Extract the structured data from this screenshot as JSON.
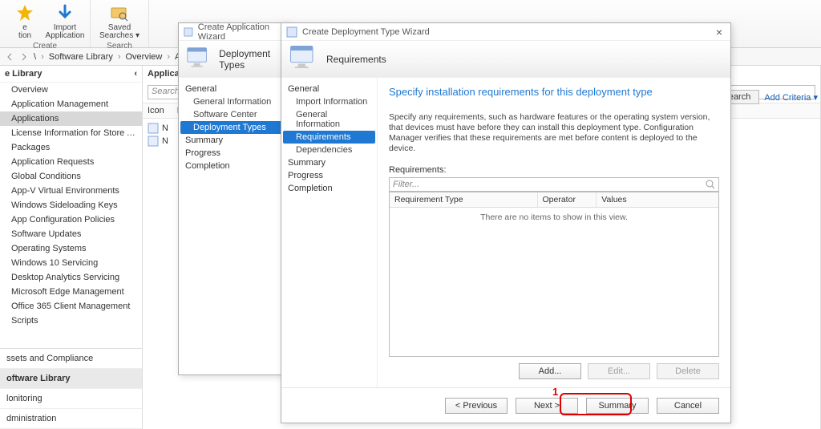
{
  "ribbon": {
    "group1": {
      "btn1a": "e",
      "btn1b": "tion",
      "btn2a": "Import",
      "btn2b": "Application",
      "label": "Create"
    },
    "group2": {
      "btn1a": "Saved",
      "btn1b": "Searches ▾",
      "label": "Search"
    }
  },
  "breadcrumb": {
    "items": [
      "\\",
      "›",
      "Software Library",
      "›",
      "Overview",
      "›",
      "Ap"
    ]
  },
  "navtree": {
    "title": "e Library",
    "nodes": [
      "Overview",
      "Application Management",
      "Applications",
      "License Information for Store Apps",
      "Packages",
      "Application Requests",
      "Global Conditions",
      "App-V Virtual Environments",
      "Windows Sideloading Keys",
      "App Configuration Policies",
      "Software Updates",
      "Operating Systems",
      "Windows 10 Servicing",
      "Desktop Analytics Servicing",
      "Microsoft Edge Management",
      "Office 365 Client Management",
      "Scripts"
    ],
    "sections": [
      "ssets and Compliance",
      "oftware Library",
      "lonitoring",
      "dministration"
    ]
  },
  "listpane": {
    "title": "Application",
    "search_placeholder": "Search",
    "columns": [
      "Icon",
      "N"
    ],
    "row_text": "N"
  },
  "right": {
    "search": "Search",
    "criteria": "Add Criteria ▾"
  },
  "wizard_back": {
    "title": "Create Application Wizard",
    "header": "Deployment Types",
    "nav_groups": [
      "General"
    ],
    "nav_items": [
      "General Information",
      "Software Center",
      "Deployment Types"
    ],
    "after_items": [
      "Summary",
      "Progress",
      "Completion"
    ]
  },
  "wizard_front": {
    "title": "Create Deployment Type Wizard",
    "header": "Requirements",
    "nav": {
      "group": "General",
      "items": [
        "Import Information",
        "General Information",
        "Requirements",
        "Dependencies"
      ],
      "tail": [
        "Summary",
        "Progress",
        "Completion"
      ]
    },
    "heading": "Specify installation requirements for this deployment type",
    "desc": "Specify any requirements, such as hardware features or the operating system version, that devices must have before they can install this deployment type. Configuration Manager verifies that these requirements are met before content is deployed to the device.",
    "requirements_label": "Requirements:",
    "filter_placeholder": "Filter...",
    "grid_cols": [
      "Requirement Type",
      "Operator",
      "Values"
    ],
    "grid_empty": "There are no items to show in this view.",
    "btn_add": "Add...",
    "btn_edit": "Edit...",
    "btn_delete": "Delete",
    "btn_prev": "< Previous",
    "btn_next": "Next >",
    "btn_summary": "Summary",
    "btn_cancel": "Cancel",
    "annotation": "1"
  }
}
